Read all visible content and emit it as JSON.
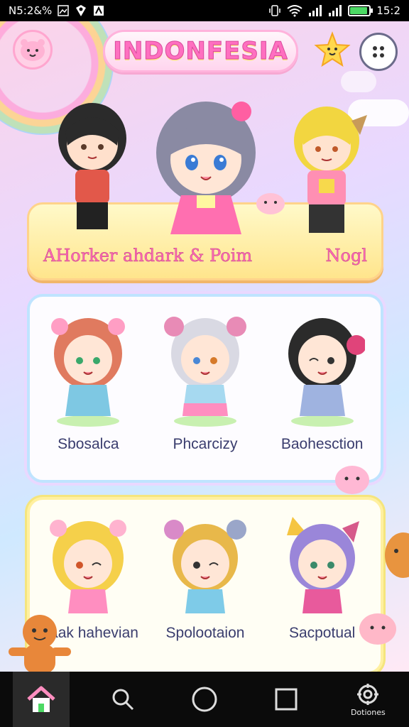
{
  "status_bar": {
    "left_text": "N5:2&%",
    "time": "15:2",
    "battery_level": 0.9
  },
  "header": {
    "title": "INDONFESIA",
    "icons": [
      "mascot-icon",
      "star-icon",
      "menu-icon"
    ]
  },
  "featured_card": {
    "left_label": "AHorker ahdark & Poim",
    "right_label": "Nogl"
  },
  "grid_row_1": [
    {
      "name": "Sbosalca"
    },
    {
      "name": "Phcarcizy"
    },
    {
      "name": "Baohesction"
    }
  ],
  "grid_row_2": [
    {
      "name": "Gaak hahevian"
    },
    {
      "name": "Spolootaion"
    },
    {
      "name": "Sacpotual"
    }
  ],
  "nav": {
    "items": [
      {
        "icon": "home-icon",
        "label": ""
      },
      {
        "icon": "search-icon",
        "label": ""
      },
      {
        "icon": "circle-icon",
        "label": ""
      },
      {
        "icon": "square-icon",
        "label": ""
      },
      {
        "icon": "settings-icon",
        "label": "Dotiones"
      }
    ]
  },
  "colors": {
    "title": "#ff6fc0",
    "card_yellow": "#ffe58c",
    "card_blue_border": "#bfe4ff",
    "name_text": "#3a3d6e"
  }
}
